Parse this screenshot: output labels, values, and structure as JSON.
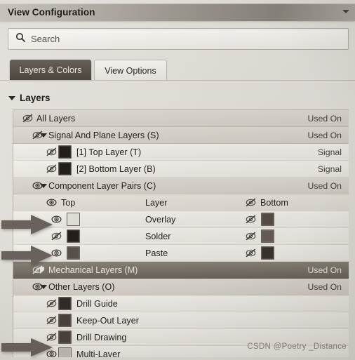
{
  "window": {
    "title": "View Configuration",
    "menu_caret_icon": "chevron-down-icon"
  },
  "search": {
    "placeholder": "Search",
    "value": "",
    "icon": "search-icon"
  },
  "tabs": [
    {
      "label": "Layers & Colors",
      "selected": true
    },
    {
      "label": "View Options",
      "selected": false
    }
  ],
  "layers_section": {
    "title": "Layers",
    "expanded": true
  },
  "column_header": {
    "top": "Top",
    "layer": "Layer",
    "bottom": "Bottom",
    "top_eye": "eye-visible-icon",
    "bottom_eye": "eye-hidden-icon"
  },
  "rows": [
    {
      "id": "all-layers",
      "label": "All Layers",
      "status": "Used On",
      "eye": "eye-hidden-icon",
      "indent": 0,
      "type": "cat",
      "twisty": "none",
      "swatch": null
    },
    {
      "id": "signal-plane",
      "label": "Signal And Plane Layers (S)",
      "status": "Used On",
      "eye": "eye-hidden-icon",
      "indent": 1,
      "type": "cat",
      "twisty": "expanded",
      "swatch": null
    },
    {
      "id": "top-layer",
      "label": "[1] Top Layer (T)",
      "status": "Signal",
      "eye": "eye-hidden-icon",
      "indent": 2,
      "type": "leaf",
      "twisty": "none",
      "swatch": "#241f1c"
    },
    {
      "id": "bottom-layer",
      "label": "[2] Bottom Layer (B)",
      "status": "Signal",
      "eye": "eye-hidden-icon",
      "indent": 2,
      "type": "leaf",
      "twisty": "none",
      "swatch": "#241f1c"
    },
    {
      "id": "component-pairs",
      "label": "Component Layer Pairs (C)",
      "status": "Used On",
      "eye": "eye-visible-icon",
      "indent": 1,
      "type": "cat",
      "twisty": "expanded",
      "swatch": null
    },
    {
      "id": "mechanical-layers",
      "label": "Mechanical Layers (M)",
      "status": "Used On",
      "eye": "eye-hidden-icon",
      "indent": 1,
      "type": "sel",
      "twisty": "collapsed",
      "swatch": null
    },
    {
      "id": "other-layers",
      "label": "Other Layers (O)",
      "status": "Used On",
      "eye": "eye-visible-icon",
      "indent": 1,
      "type": "cat",
      "twisty": "expanded",
      "swatch": null
    },
    {
      "id": "drill-guide",
      "label": "Drill Guide",
      "status": "",
      "eye": "eye-hidden-icon",
      "indent": 2,
      "type": "leaf",
      "twisty": "none",
      "swatch": "#332d29"
    },
    {
      "id": "keep-out-layer",
      "label": "Keep-Out Layer",
      "status": "",
      "eye": "eye-hidden-icon",
      "indent": 2,
      "type": "leaf",
      "twisty": "none",
      "swatch": "#4b433d"
    },
    {
      "id": "drill-drawing",
      "label": "Drill Drawing",
      "status": "",
      "eye": "eye-hidden-icon",
      "indent": 2,
      "type": "leaf",
      "twisty": "none",
      "swatch": "#4b433d"
    },
    {
      "id": "multi-layer",
      "label": "Multi-Layer",
      "status": "",
      "eye": "eye-visible-icon",
      "indent": 2,
      "type": "leaf",
      "twisty": "none",
      "swatch": "#c8c4bd"
    }
  ],
  "pair_rows": [
    {
      "id": "overlay",
      "label": "Overlay",
      "top_eye": "eye-visible-icon",
      "top_swatch": "#e7e5e0",
      "bottom_eye": "eye-hidden-icon",
      "bottom_swatch": "#584f48"
    },
    {
      "id": "solder",
      "label": "Solder",
      "top_eye": "eye-hidden-icon",
      "top_swatch": "#241f1c",
      "bottom_eye": "eye-hidden-icon",
      "bottom_swatch": "#6a6058"
    },
    {
      "id": "paste",
      "label": "Paste",
      "top_eye": "eye-visible-icon",
      "top_swatch": "#5b534c",
      "bottom_eye": "eye-hidden-icon",
      "bottom_swatch": "#3b342f"
    }
  ],
  "annotation_arrows": [
    {
      "id": "arrow-overlay",
      "points_to": "Overlay"
    },
    {
      "id": "arrow-paste",
      "points_to": "Paste"
    },
    {
      "id": "arrow-multi-layer",
      "points_to": "Multi-Layer"
    }
  ],
  "watermark": "CSDN @Poetry _Distance",
  "colors": {
    "titlebar_dark": "#8d8880",
    "selected_tab": "#5a534c",
    "selected_row": "#7a746b",
    "panel_bg": "#f4f2ee"
  }
}
